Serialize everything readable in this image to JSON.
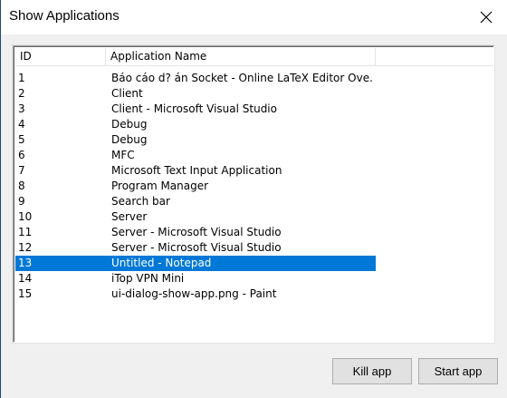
{
  "window": {
    "title": "Show Applications"
  },
  "table": {
    "columns": {
      "id": "ID",
      "name": "Application Name"
    },
    "rows": [
      {
        "id": "1",
        "name": "Báo cáo d? án Socket - Online LaTeX Editor Ove..."
      },
      {
        "id": "2",
        "name": "Client"
      },
      {
        "id": "3",
        "name": "Client - Microsoft Visual Studio"
      },
      {
        "id": "4",
        "name": "Debug"
      },
      {
        "id": "5",
        "name": "Debug"
      },
      {
        "id": "6",
        "name": "MFC"
      },
      {
        "id": "7",
        "name": "Microsoft Text Input Application"
      },
      {
        "id": "8",
        "name": "Program Manager"
      },
      {
        "id": "9",
        "name": "Search bar"
      },
      {
        "id": "10",
        "name": "Server"
      },
      {
        "id": "11",
        "name": "Server - Microsoft Visual Studio"
      },
      {
        "id": "12",
        "name": "Server - Microsoft Visual Studio"
      },
      {
        "id": "13",
        "name": "Untitled - Notepad",
        "selected": true
      },
      {
        "id": "14",
        "name": "iTop VPN Mini"
      },
      {
        "id": "15",
        "name": "ui-dialog-show-app.png - Paint"
      }
    ]
  },
  "buttons": {
    "kill": "Kill app",
    "start": "Start app"
  },
  "colors": {
    "selection": "#0078d7",
    "background": "#f0f0f0"
  }
}
